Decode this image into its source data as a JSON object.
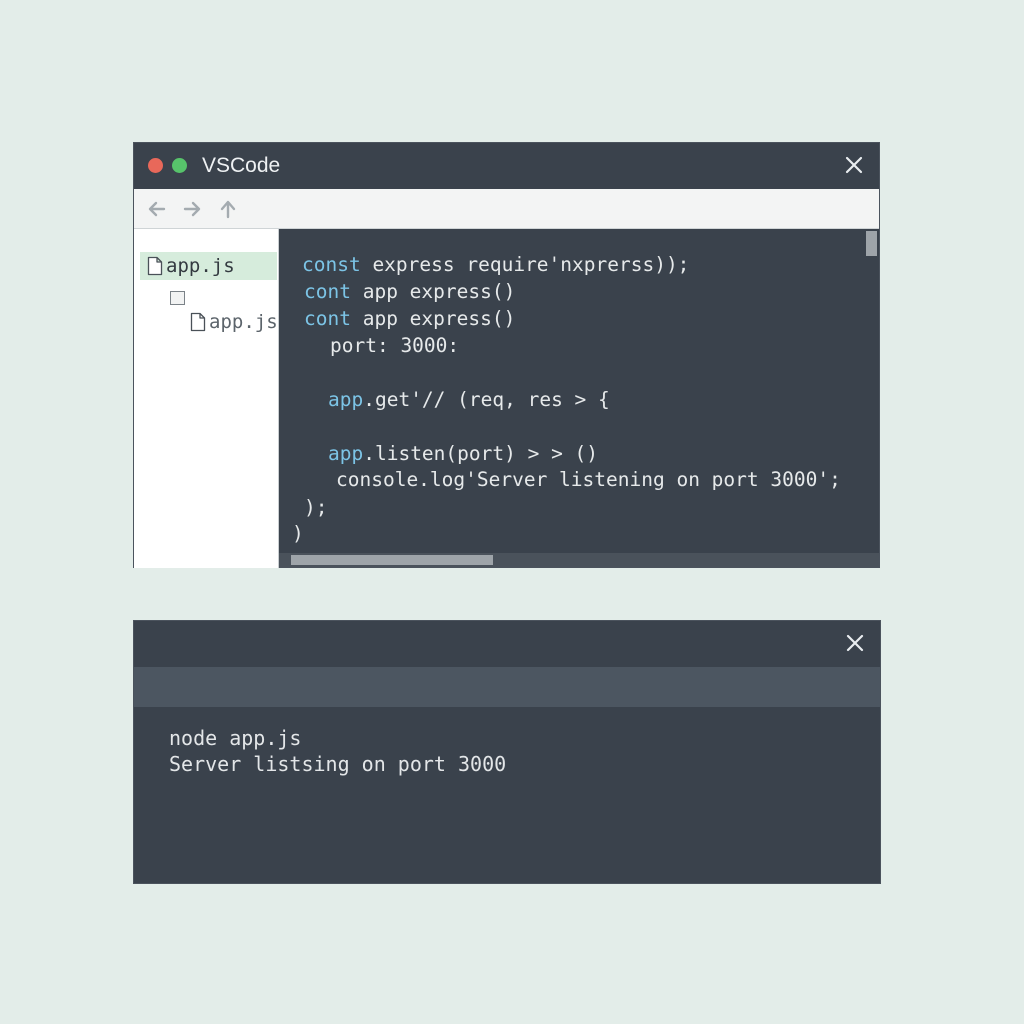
{
  "editor": {
    "title": "VSCode",
    "sidebar": {
      "items": [
        {
          "label": "app.js"
        },
        {
          "label": "app.js"
        }
      ]
    },
    "code_lines": [
      {
        "kw": "const",
        "rest": " express require'nxprerss));"
      },
      {
        "kw": "cont",
        "rest": " app express()"
      },
      {
        "kw": "cont",
        "rest": " app express()"
      },
      {
        "kw": "",
        "rest": "port: 3000:"
      },
      {
        "kw": "app",
        "rest": ".get'// (req, res > {"
      },
      {
        "kw": "app",
        "rest": ".listen(port) > > ()"
      },
      {
        "kw": "",
        "rest": "console.log'Server listening on port 3000';"
      },
      {
        "kw": "",
        "rest": ");"
      },
      {
        "kw": "",
        "rest": ")"
      }
    ]
  },
  "terminal": {
    "lines": [
      "node app.js",
      "Server listsing on port 3000"
    ]
  },
  "icons": {
    "close": "close-icon",
    "back": "arrow-left-icon",
    "forward": "arrow-right-icon",
    "up": "arrow-up-icon",
    "file": "file-icon",
    "folder": "folder-icon"
  },
  "colors": {
    "window_bg": "#3a424c",
    "keyword": "#7cc4e6",
    "active_item": "#d6ecdc",
    "dot_red": "#e8685a",
    "dot_green": "#57c36b"
  }
}
